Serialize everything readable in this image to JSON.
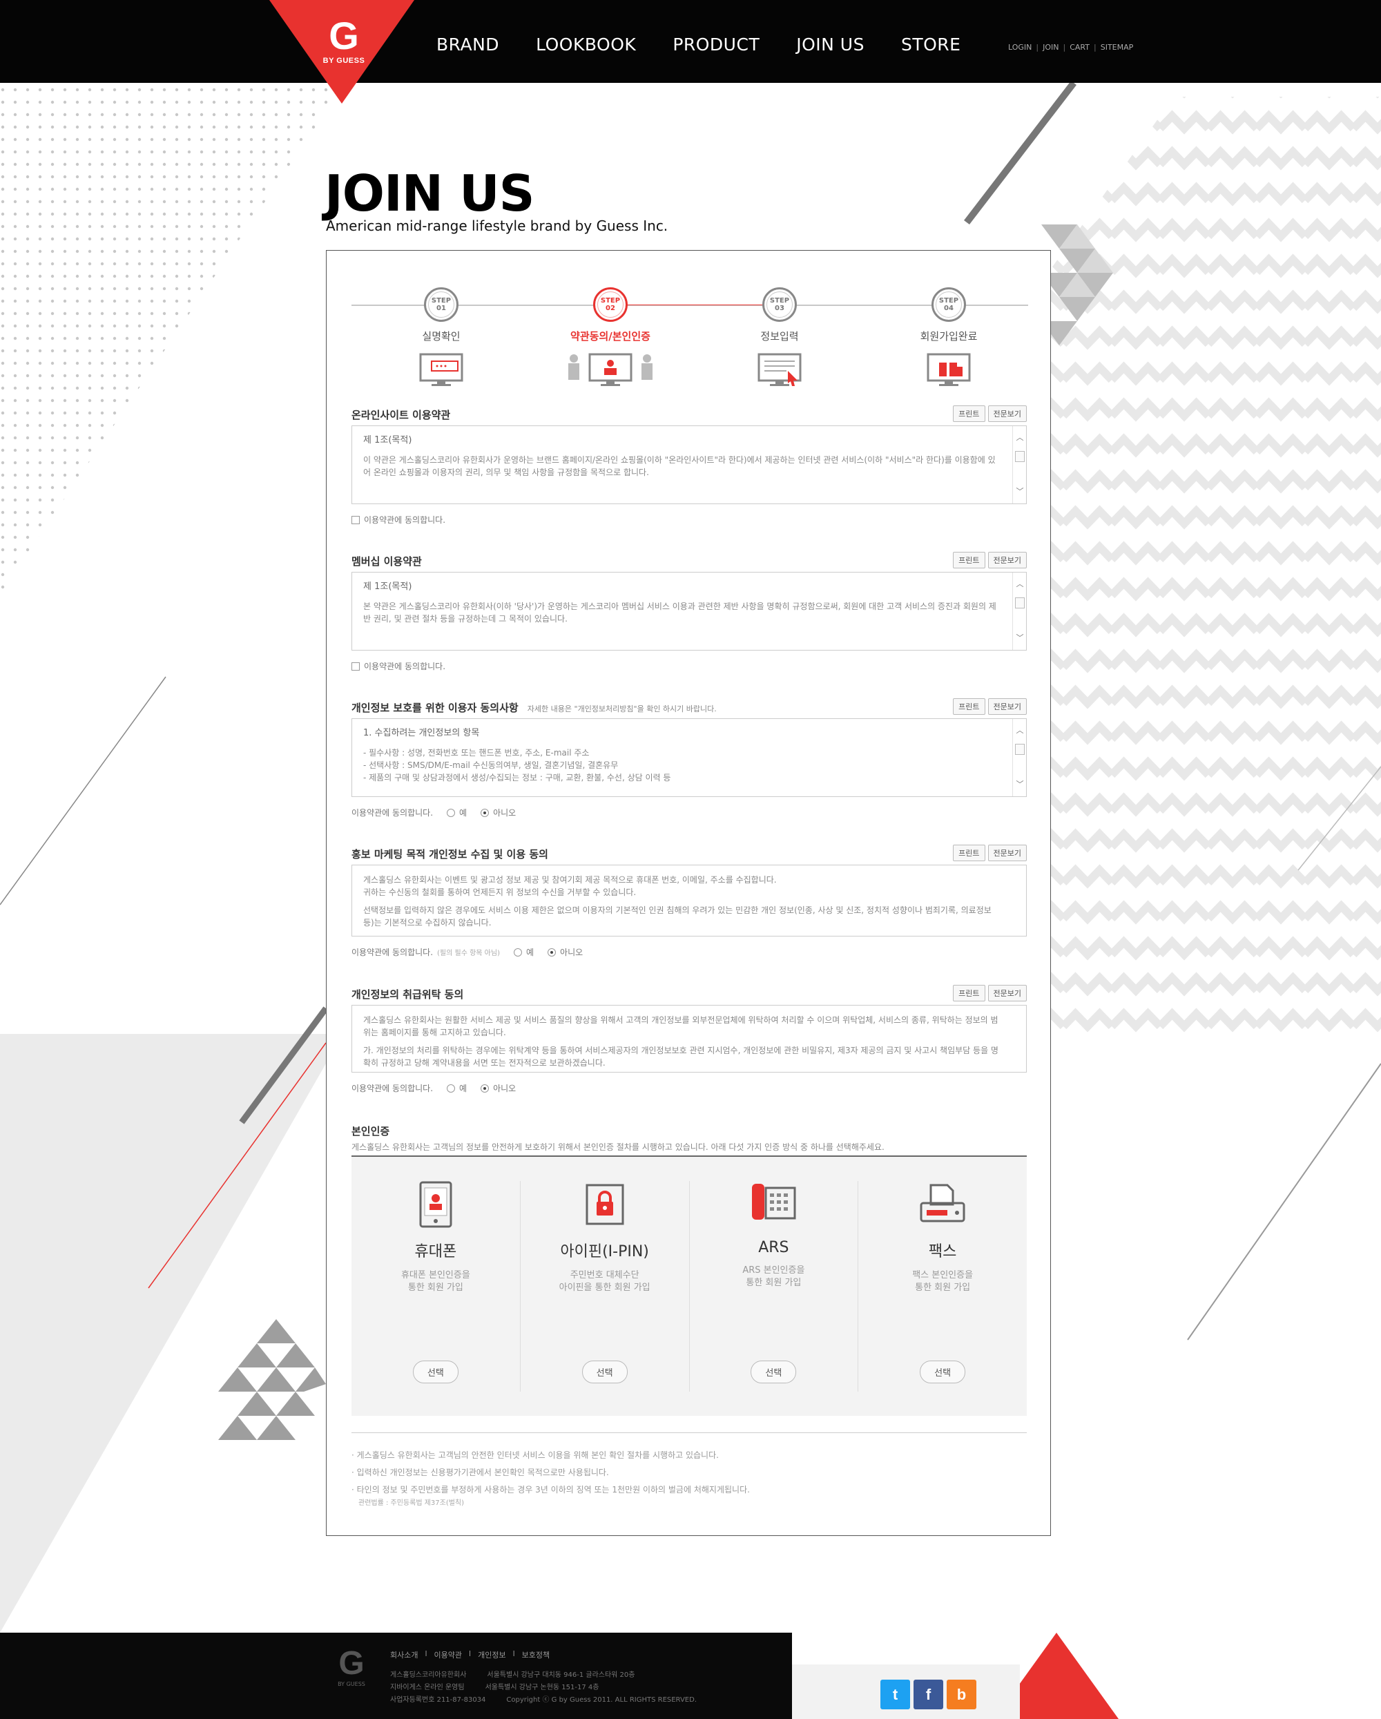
{
  "header": {
    "logo": {
      "letter": "G",
      "sub": "BY GUESS"
    },
    "nav": [
      "BRAND",
      "LOOKBOOK",
      "PRODUCT",
      "JOIN US",
      "STORE"
    ],
    "util": [
      "LOGIN",
      "JOIN",
      "CART",
      "SITEMAP"
    ]
  },
  "page": {
    "title": "JOIN US",
    "subtitle": "American mid-range lifestyle brand by Guess Inc."
  },
  "steps": [
    {
      "code": "STEP 01",
      "label": "실명확인",
      "active": false
    },
    {
      "code": "STEP 02",
      "label": "약관동의/본인인증",
      "active": true
    },
    {
      "code": "STEP 03",
      "label": "정보입력",
      "active": false
    },
    {
      "code": "STEP 04",
      "label": "회원가입완료",
      "active": false
    }
  ],
  "buttons": {
    "print": "프린트",
    "fullview": "전문보기"
  },
  "sections": {
    "site_terms": {
      "title": "온라인사이트 이용약관",
      "head": "제 1조(목적)",
      "text": "이 약관은 게스홀딩스코리아 유한회사가 운영하는 브랜드 홈페이지/온라인 쇼핑몰(이하 \"온라인사이트\"라 한다)에서 제공하는 인터넷 관련 서비스(이하 \"서비스\"라 한다)를 이용함에 있어 온라인 쇼핑몰과 이용자의 권리, 의무 및 책임 사항을 규정함을 목적으로 합니다.",
      "agree": "이용약관에 동의합니다."
    },
    "member_terms": {
      "title": "멤버십 이용약관",
      "head": "제 1조(목적)",
      "text": "본 약관은 게스홀딩스코리아 유한회사(이하 '당사')가 운영하는 게스코리아 멤버십 서비스 이용과 관련한 제반 사항을 명확히 규정함으로써, 회원에 대한 고객 서비스의 증진과 회원의 제반 권리, 및 관련 절차 등을 규정하는데 그 목적이 있습니다.",
      "agree": "이용약관에 동의합니다."
    },
    "privacy": {
      "title": "개인정보 보호를 위한 이용자 동의사항",
      "note": "자세한 내용은 \"개인정보처리방침\"을 확인 하시기 바랍니다.",
      "head": "1. 수집하려는 개인정보의 항목",
      "lines": [
        "- 필수사항 : 성명, 전화번호 또는 핸드폰 번호, 주소, E-mail 주소",
        "- 선택사항 : SMS/DM/E-mail 수신동의여부, 생일, 결혼기념일, 결혼유무",
        "- 제품의 구매 및 상담과정에서 생성/수집되는 정보 : 구매, 교환, 환불, 수선, 상담 이력 등"
      ],
      "agree": "이용약관에 동의합니다.",
      "yes": "예",
      "no": "아니오"
    },
    "marketing": {
      "title": "홍보 마케팅 목적 개인정보 수집 및 이용 동의",
      "lines": [
        "게스홀딩스 유한회사는 이벤트 및 광고성 정보 제공 및 참여기회 제공 목적으로 휴대폰 번호, 이메일, 주소를 수집합니다.",
        "귀하는 수신동의 철회를 통하여 언제든지 위 정보의 수신을 거부할 수 있습니다.",
        "선택정보를 입력하지 않은 경우에도 서비스 이용 제한은 없으며 이용자의 기본적인 인권 침해의 우려가 있는 민감한 개인 정보(인종, 사상 및 신조, 정치적 성향이나 범죄기록, 의료정보 등)는 기본적으로 수집하지 않습니다."
      ],
      "agree": "이용약관에 동의합니다.",
      "agree_sub": "(필의 필수 항목 아님)",
      "yes": "예",
      "no": "아니오"
    },
    "consign": {
      "title": "개인정보의 취급위탁 동의",
      "lines": [
        "게스홀딩스 유한회사는 원활한 서비스 제공 및 서비스 품질의 향상을 위해서 고객의 개인정보를 외부전문업체에 위탁하여 처리할 수 이으며 위탁업체, 서비스의 종류, 위탁하는 정보의 범위는 홈페이지를 통해 고지하고 있습니다.",
        "가. 개인정보의 처리를 위탁하는 경우에는 위탁계약 등을 통하여 서비스제공자의 개인정보보호 관련 지시엄수, 개인정보에 관한 비밀유지, 제3자 제공의 금지 및 사고시 책임부담 등을 명확히 규정하고 당해 계약내용을 서면 또는 전자적으로 보관하겠습니다."
      ],
      "agree": "이용약관에 동의합니다.",
      "yes": "예",
      "no": "아니오"
    }
  },
  "verify": {
    "title": "본인인증",
    "desc": "게스홀딩스 유한회사는 고객님의 정보를 안전하게 보호하기 위해서 본인인증 절차를 시행하고 있습니다. 아래 다섯 가지 인증 방식 중 하나를 선택해주세요.",
    "methods": [
      {
        "name": "휴대폰",
        "desc1": "휴대폰 본인인증을",
        "desc2": "통한 회원 가입",
        "icon": "phone-icon"
      },
      {
        "name": "아이핀(I-PIN)",
        "desc1": "주민번호 대체수단",
        "desc2": "아이핀을 통한 회원 가입",
        "icon": "lock-icon"
      },
      {
        "name": "ARS",
        "desc1": "ARS 본인인증을",
        "desc2": "통한 회원 가입",
        "icon": "telephone-icon"
      },
      {
        "name": "팩스",
        "desc1": "팩스 본인인증을",
        "desc2": "통한 회원 가입",
        "icon": "fax-icon"
      }
    ],
    "select": "선택",
    "notes": [
      "· 게스홀딩스 유한회사는 고객님의 안전한 인터넷 서비스 이용을 위해 본인 확인 절차를 시행하고 있습니다.",
      "· 입력하신 개인정보는 신용평가기관에서 본인확인 목적으로만 사용됩니다.",
      "· 타인의 정보 및 주민번호를 부정하게 사용하는 경우 3년 이하의 징역 또는 1천만원 이하의 벌금에 처해지게됩니다."
    ],
    "law": "관련법률 : 주민등록법 제37조(벌칙)"
  },
  "footer": {
    "logo": {
      "letter": "G",
      "sub": "BY GUESS"
    },
    "links": [
      "회사소개",
      "l",
      "이용약관",
      "l",
      "개인정보",
      "l",
      "보호정책"
    ],
    "info_left": [
      "게스홀딩스코리아유한회사",
      "지바이게스 온라인 운영팀",
      "사업자등록번호 211-87-83034"
    ],
    "info_right": [
      "서울특별시 강남구 대치동 946-1 글라스타워 20층",
      "서울특별시 강남구 논현동 151-17 4층",
      "Copyright ⓒ G by Guess 2011. ALL RIGHTS RESERVED."
    ]
  },
  "social": [
    {
      "name": "twitter",
      "glyph": "t",
      "color": "#1da1f2"
    },
    {
      "name": "facebook",
      "glyph": "f",
      "color": "#3b5998"
    },
    {
      "name": "blog",
      "glyph": "b",
      "color": "#f57d20"
    }
  ],
  "colors": {
    "accent": "#e8322f",
    "header": "#050505"
  }
}
